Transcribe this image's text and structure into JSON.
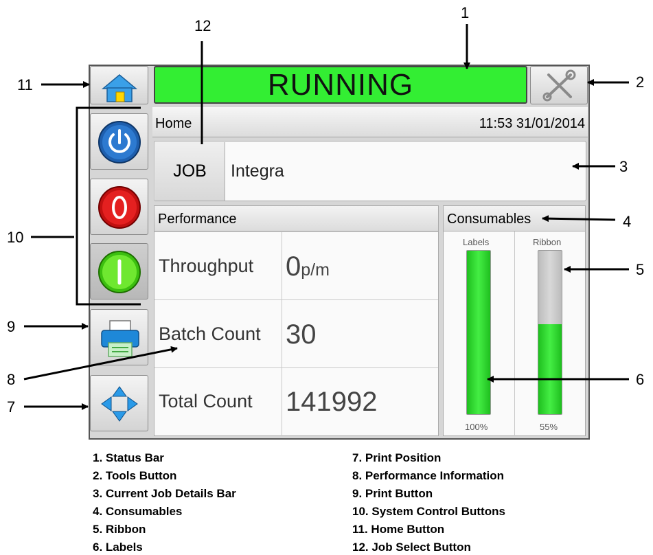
{
  "status_bar": {
    "text": "RUNNING",
    "color": "#33ee33"
  },
  "header": {
    "breadcrumb": "Home",
    "datetime": "11:53 31/01/2014"
  },
  "job": {
    "button_label": "JOB",
    "name": "Integra"
  },
  "performance": {
    "title": "Performance",
    "rows": [
      {
        "label": "Throughput",
        "value": "0",
        "unit": "p/m"
      },
      {
        "label": "Batch Count",
        "value": "30",
        "unit": ""
      },
      {
        "label": "Total Count",
        "value": "141992",
        "unit": ""
      }
    ]
  },
  "consumables": {
    "title": "Consumables",
    "gauges": [
      {
        "label": "Labels",
        "percent_text": "100%",
        "level": 1.0
      },
      {
        "label": "Ribbon",
        "percent_text": "55%",
        "level": 0.55
      }
    ]
  },
  "icons": {
    "home": "home-icon",
    "tools": "tools-icon",
    "power": "power-icon",
    "stop": "stop-icon",
    "start": "start-icon",
    "print": "printer-icon",
    "position": "four-way-arrows-icon"
  },
  "callouts": [
    "1",
    "2",
    "3",
    "4",
    "5",
    "6",
    "7",
    "8",
    "9",
    "10",
    "11",
    "12"
  ],
  "legend": {
    "left": [
      "1. Status Bar",
      "2. Tools Button",
      "3. Current Job Details Bar",
      "4. Consumables",
      "5. Ribbon",
      "6. Labels"
    ],
    "right": [
      "7. Print Position",
      "8. Performance Information",
      "9. Print Button",
      "10. System Control Buttons",
      "11. Home Button",
      "12. Job Select Button"
    ]
  }
}
